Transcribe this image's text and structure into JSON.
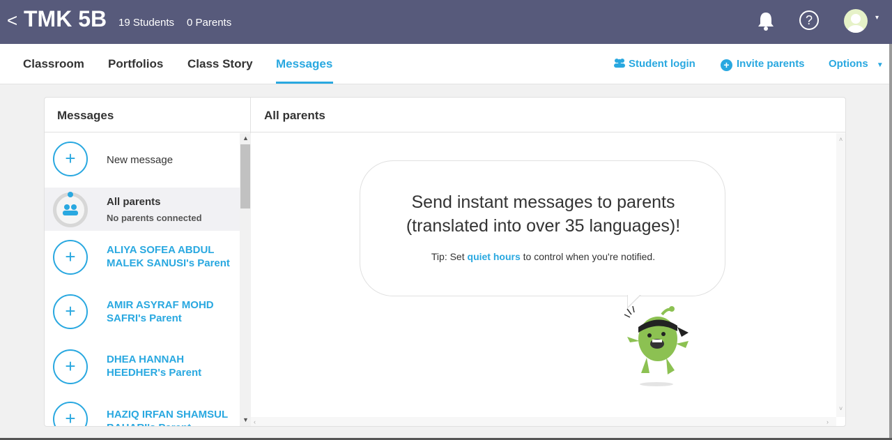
{
  "header": {
    "back_glyph": "<",
    "class_name": "TMK 5B",
    "students": "19 Students",
    "parents": "0 Parents",
    "help_glyph": "?",
    "caret_glyph": "▾"
  },
  "nav": {
    "tabs": [
      {
        "label": "Classroom"
      },
      {
        "label": "Portfolios"
      },
      {
        "label": "Class Story"
      },
      {
        "label": "Messages"
      }
    ],
    "active": "Messages",
    "student_login": "Student login",
    "invite_parents": "Invite parents",
    "options": "Options"
  },
  "messages": {
    "header": "Messages",
    "new_message": "New message",
    "all_parents": {
      "title": "All parents",
      "subtitle": "No parents connected"
    },
    "contacts": [
      {
        "line1": "ALIYA SOFEA ABDUL",
        "line2": "MALEK SANUSI's Parent"
      },
      {
        "line1": "AMIR ASYRAF MOHD",
        "line2": "SAFRI's Parent"
      },
      {
        "line1": "DHEA HANNAH",
        "line2": "HEEDHER's Parent"
      },
      {
        "line1": "HAZIQ IRFAN SHAMSUL",
        "line2": "BAHARI's Parent"
      }
    ]
  },
  "conversation": {
    "header": "All parents",
    "bubble_line1": "Send instant messages to parents",
    "bubble_line2": "(translated into over 35 languages)!",
    "tip_prefix": "Tip: Set ",
    "tip_link": "quiet hours",
    "tip_suffix": " to control when you're notified."
  },
  "colors": {
    "topbar": "#575a7b",
    "accent": "#29a8e0",
    "monster": "#8cc152"
  }
}
